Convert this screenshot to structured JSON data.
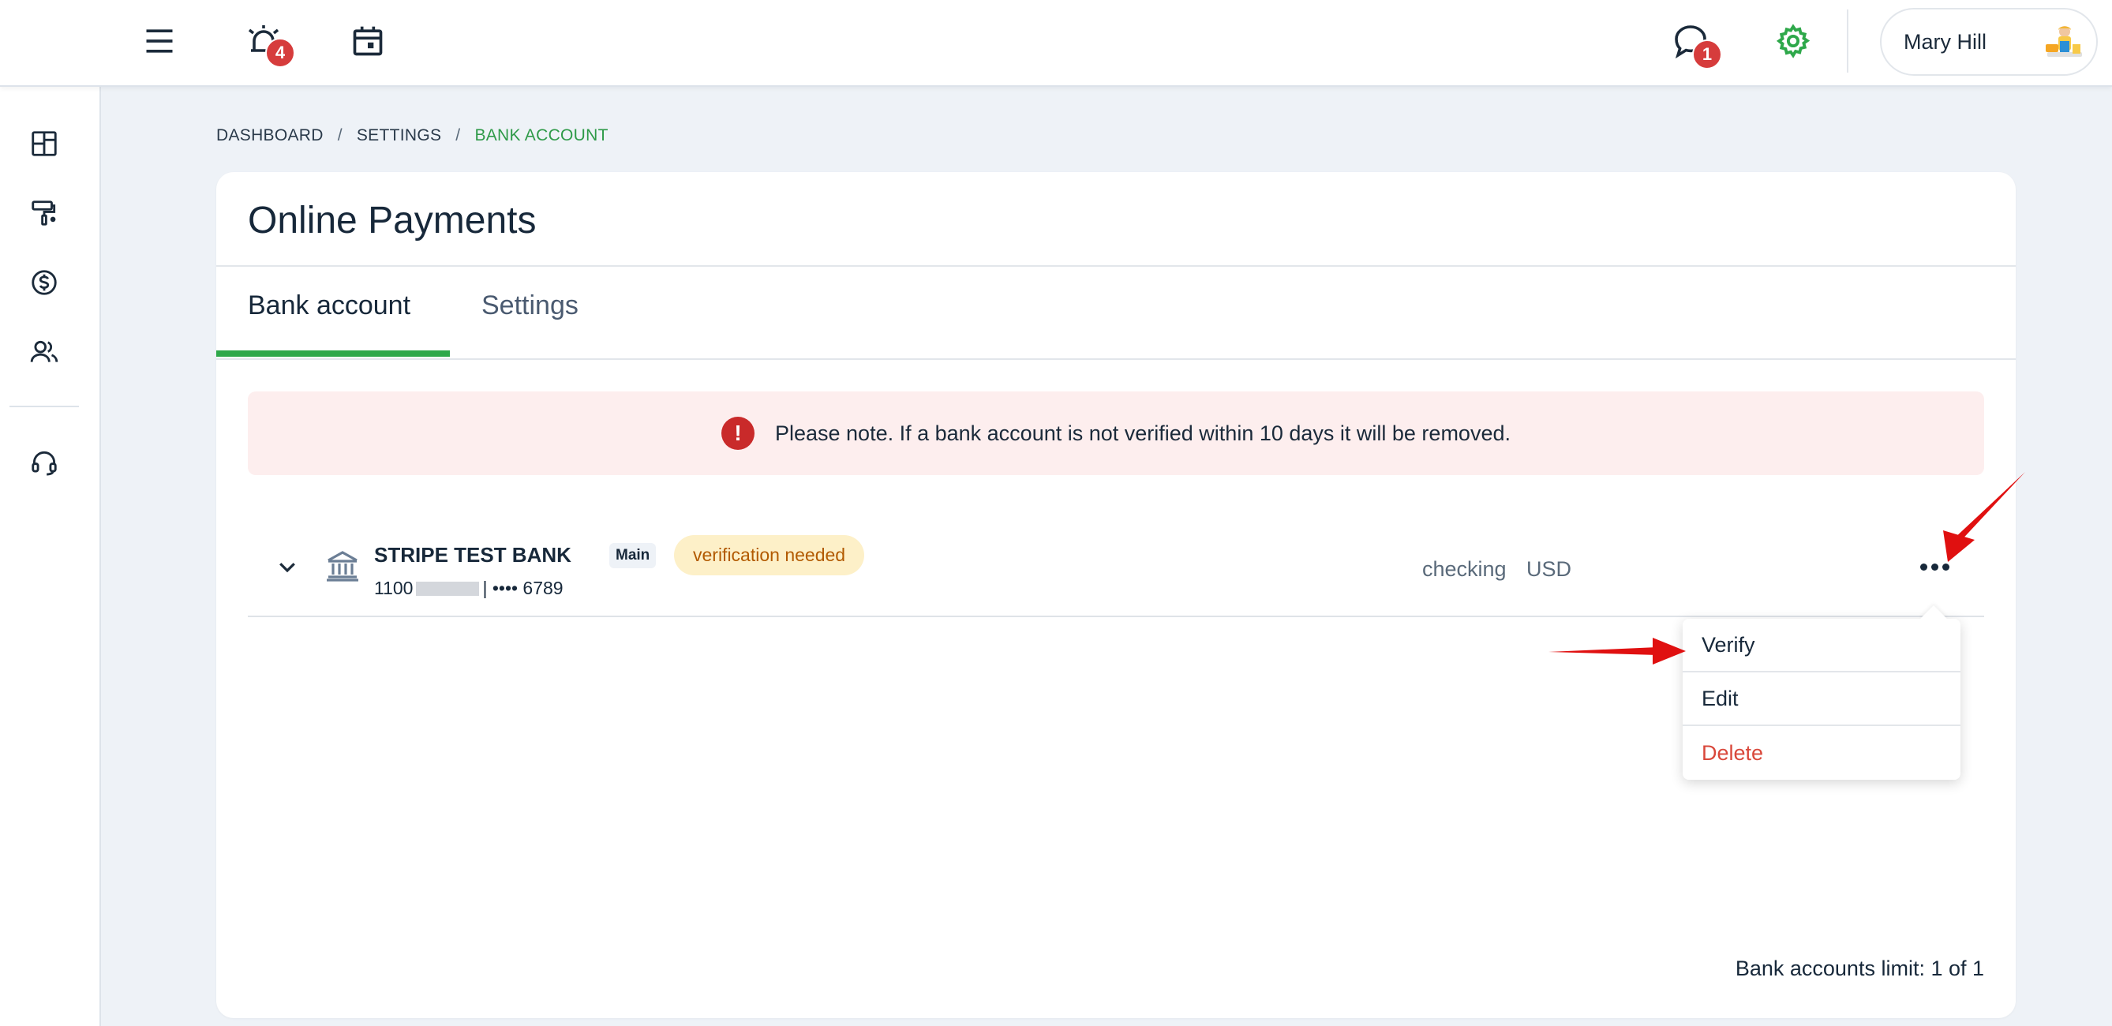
{
  "topbar": {
    "notifications_count": "4",
    "messages_count": "1",
    "user_name": "Mary Hill"
  },
  "breadcrumb": {
    "items": [
      "DASHBOARD",
      "SETTINGS",
      "BANK ACCOUNT"
    ],
    "separator": "/"
  },
  "page": {
    "title": "Online Payments",
    "tabs": [
      {
        "label": "Bank account",
        "active": true
      },
      {
        "label": "Settings",
        "active": false
      }
    ]
  },
  "alert": {
    "icon": "!",
    "text": "Please note. If a bank account is not verified within 10 days it will be removed."
  },
  "bank_account": {
    "name": "STRIPE TEST BANK",
    "tag": "Main",
    "status": "verification needed",
    "number_prefix": "1100",
    "number_suffix": "| •••• 6789",
    "type": "checking",
    "currency": "USD"
  },
  "menu": {
    "items": [
      "Verify",
      "Edit",
      "Delete"
    ]
  },
  "footer": {
    "limit_text": "Bank accounts limit: 1 of 1"
  },
  "colors": {
    "accent_green": "#2ea84a",
    "alert_bg": "#fdeeee",
    "danger": "#d9483b",
    "badge_red": "#d63c3c",
    "annotation_arrow": "#e01010"
  }
}
